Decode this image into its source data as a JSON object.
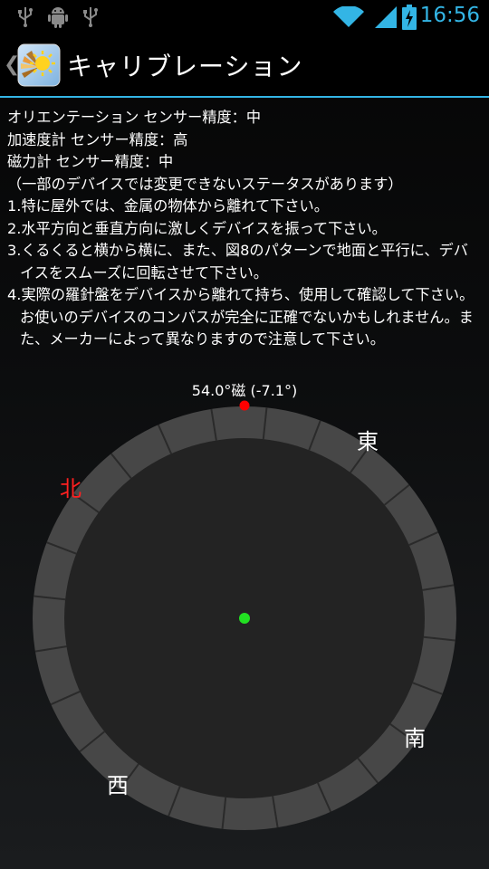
{
  "status_bar": {
    "time": "16:56",
    "left_icons": [
      "usb-icon",
      "android-debug-icon",
      "usb-icon"
    ],
    "right_icons": [
      "wifi-icon",
      "signal-icon",
      "battery-charging-icon"
    ],
    "accent_color": "#33b5e5"
  },
  "action_bar": {
    "title": "キャリブレーション"
  },
  "sensors": {
    "orientation": "オリエンテーション センサー精度：中",
    "accelerometer": "加速度計 センサー精度：高",
    "magnetometer": "磁力計 センサー精度：中",
    "note": "（一部のデバイスでは変更できないステータスがあります）"
  },
  "steps": [
    "1.特に屋外では、金属の物体から離れて下さい。",
    "2.水平方向と垂直方向に激しくデバイスを振って下さい。",
    "3.くるくると横から横に、また、図8のパターンで地面と平行に、デバイスをスムーズに回転させて下さい。",
    "4.実際の羅針盤をデバイスから離れて持ち、使用して確認して下さい。お使いのデバイスのコンパスが完全に正確でないかもしれません。また、メーカーによって異なりますので注意して下さい。"
  ],
  "compass": {
    "heading_readout": "54.0°磁 (-7.1°)",
    "heading_degrees": 54.0,
    "north": "北",
    "east": "東",
    "south": "南",
    "west": "西",
    "north_color": "#ff2020",
    "marker_color": "#ff0000",
    "center_dot_color": "#22e022"
  }
}
